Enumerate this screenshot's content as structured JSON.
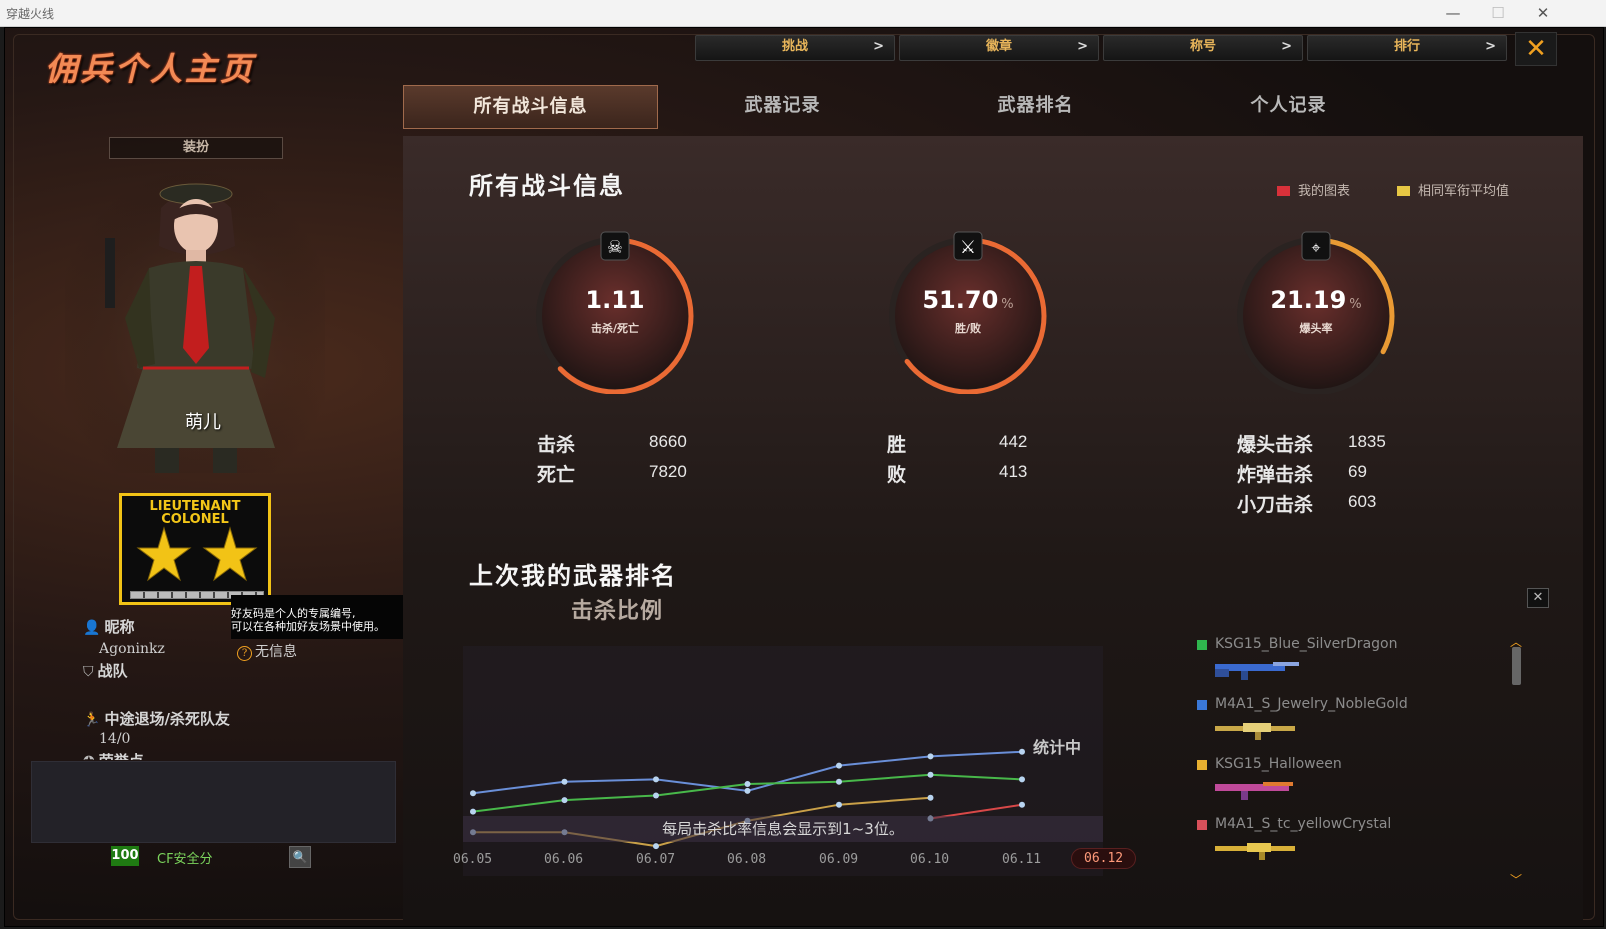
{
  "window": {
    "title": "穿越火线"
  },
  "app": {
    "title": "佣兵个人主页"
  },
  "top_tabs": [
    "挑战",
    "徽章",
    "称号",
    "排行"
  ],
  "sub_tabs": [
    "所有战斗信息",
    "武器记录",
    "武器排名",
    "个人记录"
  ],
  "sub_tab_active": 0,
  "left": {
    "dress_button": "装扮",
    "character_name": "萌儿",
    "rank_line1": "LIEUTENANT",
    "rank_line2": "COLONEL",
    "tooltip_line1": "好友码是个人的专属编号,",
    "tooltip_line2": "可以在各种加好友场景中使用。",
    "nickname_label": "昵称",
    "nickname_value": "Agoninkz",
    "friend_code_value": "无信息",
    "team_label": "战队",
    "quit_label": "中途退场/杀死队友",
    "quit_value": "14/0",
    "honor_label": "荣誉点",
    "safety_score": "100",
    "safety_label": "CF安全分"
  },
  "panel": {
    "title": "所有战斗信息",
    "legend_mine": "我的图表",
    "legend_avg": "相同军衔平均值",
    "colors": {
      "mine": "#d8313a",
      "avg": "#e6c744"
    },
    "gauges": [
      {
        "value": "1.11",
        "unit": "",
        "label": "击杀/死亡",
        "icon": "skull-icon",
        "fill": 0.6
      },
      {
        "value": "51.70",
        "unit": "%",
        "label": "胜/败",
        "icon": "crossed-rifles-icon",
        "fill": 0.62
      },
      {
        "value": "21.19",
        "unit": "%",
        "label": "爆头率",
        "icon": "headshot-rifle-icon",
        "fill": 0.3
      }
    ],
    "stats": {
      "kill_label": "击杀",
      "kill_value": "8660",
      "death_label": "死亡",
      "death_value": "7820",
      "win_label": "胜",
      "win_value": "442",
      "lose_label": "败",
      "lose_value": "413",
      "headshot_label": "爆头击杀",
      "headshot_value": "1835",
      "bomb_label": "炸弹击杀",
      "bomb_value": "69",
      "knife_label": "小刀击杀",
      "knife_value": "603"
    },
    "weapon_title": "上次我的武器排名",
    "weapon_sub": "击杀比例",
    "stat_computing": "统计中",
    "chart_note": "每局击杀比率信息会显示到1~3位。",
    "dates": [
      "06.05",
      "06.06",
      "06.07",
      "06.08",
      "06.09",
      "06.10",
      "06.11",
      "06.12"
    ],
    "date_active": 7,
    "weapons": [
      {
        "name": "KSG15_Blue_SilverDragon",
        "color": "#2fb64e"
      },
      {
        "name": "M4A1_S_Jewelry_NobleGold",
        "color": "#3a78d8"
      },
      {
        "name": "KSG15_Halloween",
        "color": "#e8b030"
      },
      {
        "name": "M4A1_S_tc_yellowCrystal",
        "color": "#d8505a"
      }
    ]
  },
  "chart_data": {
    "type": "line",
    "x": [
      "06.05",
      "06.06",
      "06.07",
      "06.08",
      "06.09",
      "06.10",
      "06.11"
    ],
    "series": [
      {
        "color": "#6a8fd8",
        "values": [
          0.36,
          0.41,
          0.42,
          0.37,
          0.48,
          0.52,
          0.54
        ]
      },
      {
        "color": "#48b84a",
        "values": [
          0.28,
          0.33,
          0.35,
          0.4,
          0.41,
          0.44,
          0.42
        ]
      },
      {
        "color": "#c9a048",
        "values": [
          0.19,
          0.19,
          0.13,
          0.24,
          0.31,
          0.34,
          null
        ]
      },
      {
        "color": "#d84848",
        "values": [
          null,
          null,
          null,
          null,
          null,
          0.25,
          0.31
        ]
      }
    ],
    "ylim": [
      0,
      1
    ]
  }
}
